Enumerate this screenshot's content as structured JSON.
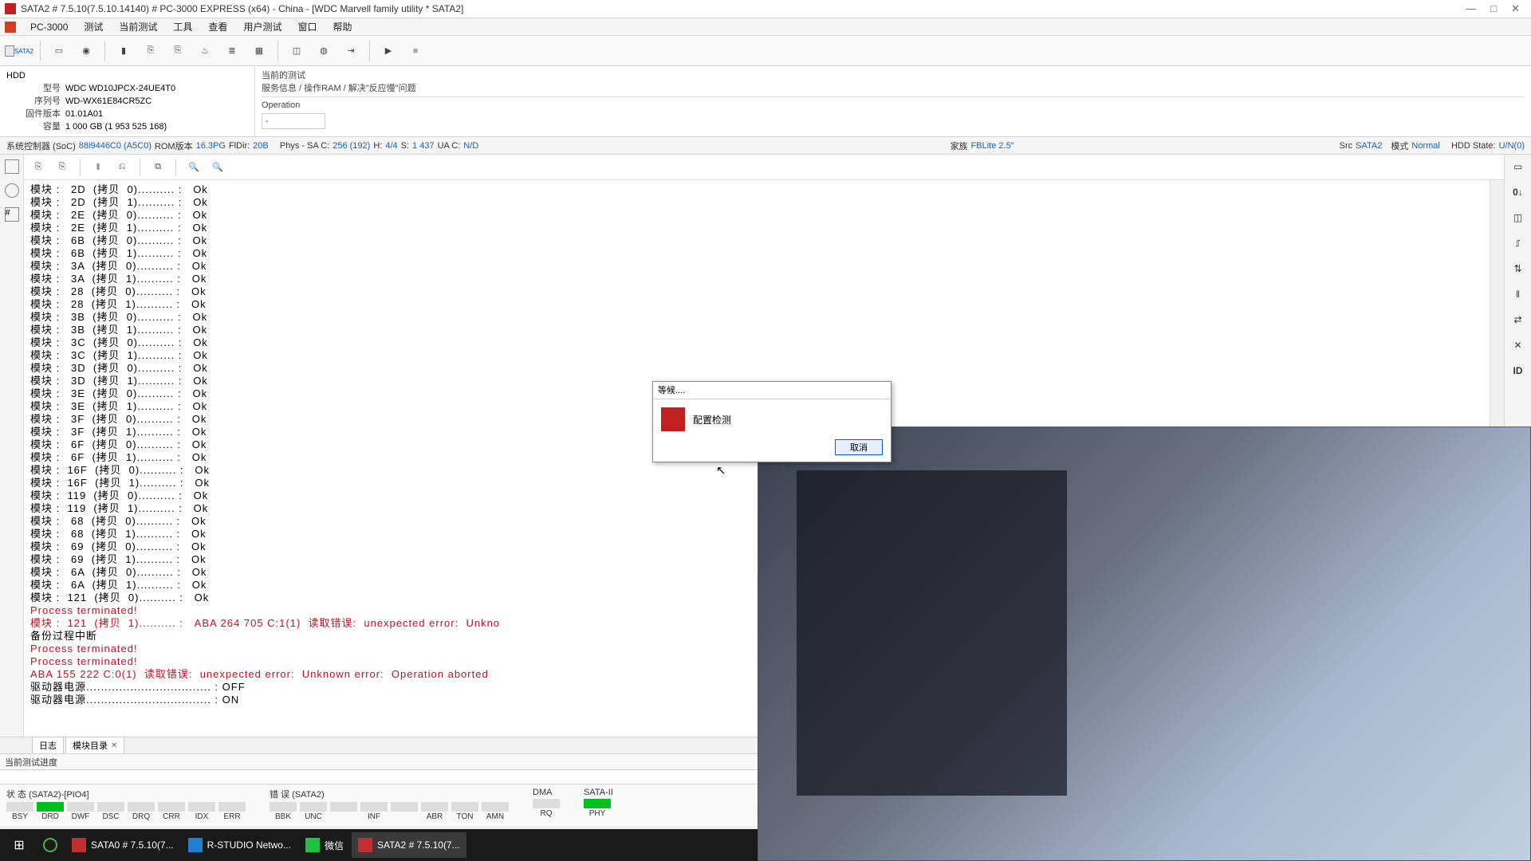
{
  "window": {
    "title": "SATA2 # 7.5.10(7.5.10.14140) # PC-3000 EXPRESS (x64) - China - [WDC Marvell family utility * SATA2]",
    "minimize": "—",
    "maximize": "□",
    "close": "✕"
  },
  "menubar": {
    "appname": "PC-3000",
    "items": [
      "测试",
      "当前测试",
      "工具",
      "查看",
      "用户测试",
      "窗口",
      "帮助"
    ]
  },
  "toolbar": {
    "sata_label": "SATA2",
    "play": "▶",
    "stop": "■"
  },
  "info": {
    "hdd_label": "HDD",
    "model_label": "型号",
    "model": "WDC WD10JPCX-24UE4T0",
    "serial_label": "序列号",
    "serial": "WD-WX61E84CR5ZC",
    "firmware_label": "固件版本",
    "firmware": "01.01A01",
    "capacity_label": "容量",
    "capacity": "1 000 GB (1 953 525 168)"
  },
  "test": {
    "current_label": "当前的测试",
    "current_value": "服务信息 / 操作RAM / 解决\"反应慢\"问题",
    "operation_label": "Operation",
    "dropdown": "-"
  },
  "statusline": {
    "soc_label": "系统控制器 (SoC)",
    "soc_value": "88i9446C0 (A5C0)",
    "rom_label": "ROM版本",
    "rom_value": "16.3PG",
    "fldir_label": "FlDir:",
    "fldir_value": "20B",
    "phys_label": "Phys - SA C:",
    "phys_value": "256 (192)",
    "h_label": "H:",
    "h_value": "4/4",
    "s_label": "S:",
    "s_value": "1 437",
    "uac_label": "UA C:",
    "uac_value": "N/D",
    "family_label": "家族",
    "family_value": "FBLite 2.5\"",
    "src_label": "Src",
    "src_value": "SATA2",
    "mode_label": "模式",
    "mode_value": "Normal",
    "hddstate_label": "HDD State:",
    "hddstate_value": "U/N(0)"
  },
  "log_lines": [
    {
      "text": "模块 :   2D  (拷贝  0).......... :   Ok",
      "cls": ""
    },
    {
      "text": "模块 :   2D  (拷贝  1).......... :   Ok",
      "cls": ""
    },
    {
      "text": "模块 :   2E  (拷贝  0).......... :   Ok",
      "cls": ""
    },
    {
      "text": "模块 :   2E  (拷贝  1).......... :   Ok",
      "cls": ""
    },
    {
      "text": "模块 :   6B  (拷贝  0).......... :   Ok",
      "cls": ""
    },
    {
      "text": "模块 :   6B  (拷贝  1).......... :   Ok",
      "cls": ""
    },
    {
      "text": "模块 :   3A  (拷贝  0).......... :   Ok",
      "cls": ""
    },
    {
      "text": "模块 :   3A  (拷贝  1).......... :   Ok",
      "cls": ""
    },
    {
      "text": "模块 :   28  (拷贝  0).......... :   Ok",
      "cls": ""
    },
    {
      "text": "模块 :   28  (拷贝  1).......... :   Ok",
      "cls": ""
    },
    {
      "text": "模块 :   3B  (拷贝  0).......... :   Ok",
      "cls": ""
    },
    {
      "text": "模块 :   3B  (拷贝  1).......... :   Ok",
      "cls": ""
    },
    {
      "text": "模块 :   3C  (拷贝  0).......... :   Ok",
      "cls": ""
    },
    {
      "text": "模块 :   3C  (拷贝  1).......... :   Ok",
      "cls": ""
    },
    {
      "text": "模块 :   3D  (拷贝  0).......... :   Ok",
      "cls": ""
    },
    {
      "text": "模块 :   3D  (拷贝  1).......... :   Ok",
      "cls": ""
    },
    {
      "text": "模块 :   3E  (拷贝  0).......... :   Ok",
      "cls": ""
    },
    {
      "text": "模块 :   3E  (拷贝  1).......... :   Ok",
      "cls": ""
    },
    {
      "text": "模块 :   3F  (拷贝  0).......... :   Ok",
      "cls": ""
    },
    {
      "text": "模块 :   3F  (拷贝  1).......... :   Ok",
      "cls": ""
    },
    {
      "text": "模块 :   6F  (拷贝  0).......... :   Ok",
      "cls": ""
    },
    {
      "text": "模块 :   6F  (拷贝  1).......... :   Ok",
      "cls": ""
    },
    {
      "text": "模块 :  16F  (拷贝  0).......... :   Ok",
      "cls": ""
    },
    {
      "text": "模块 :  16F  (拷贝  1).......... :   Ok",
      "cls": ""
    },
    {
      "text": "模块 :  119  (拷贝  0).......... :   Ok",
      "cls": ""
    },
    {
      "text": "模块 :  119  (拷贝  1).......... :   Ok",
      "cls": ""
    },
    {
      "text": "模块 :   68  (拷贝  0).......... :   Ok",
      "cls": ""
    },
    {
      "text": "模块 :   68  (拷贝  1).......... :   Ok",
      "cls": ""
    },
    {
      "text": "模块 :   69  (拷贝  0).......... :   Ok",
      "cls": ""
    },
    {
      "text": "模块 :   69  (拷贝  1).......... :   Ok",
      "cls": ""
    },
    {
      "text": "模块 :   6A  (拷贝  0).......... :   Ok",
      "cls": ""
    },
    {
      "text": "模块 :   6A  (拷贝  1).......... :   Ok",
      "cls": ""
    },
    {
      "text": "模块 :  121  (拷贝  0).......... :   Ok",
      "cls": ""
    },
    {
      "text": "Process terminated!",
      "cls": "red"
    },
    {
      "text": "模块 :  121  (拷贝  1).......... :   ABA 264 705 C:1(1)  读取错误:  unexpected error:  Unkno",
      "cls": "red"
    },
    {
      "text": "备份过程中断",
      "cls": ""
    },
    {
      "text": "",
      "cls": ""
    },
    {
      "text": "Process terminated!",
      "cls": "red"
    },
    {
      "text": "Process terminated!",
      "cls": "red"
    },
    {
      "text": "ABA 155 222 C:0(1)  读取错误:  unexpected error:  Unknown error:  Operation aborted",
      "cls": "red"
    },
    {
      "text": "驱动器电源.................................. : OFF",
      "cls": ""
    },
    {
      "text": "驱动器电源.................................. : ON",
      "cls": ""
    }
  ],
  "tabs": {
    "log": "日志",
    "modules": "模块目录"
  },
  "progress_label": "当前测试进度",
  "panels": {
    "status": {
      "title": "状 态 (SATA2)-[PIO4]",
      "chips": [
        "BSY",
        "DRD",
        "DWF",
        "DSC",
        "DRQ",
        "CRR",
        "IDX",
        "ERR"
      ],
      "green": [
        1
      ]
    },
    "errors": {
      "title": "错 误 (SATA2)",
      "chips": [
        "BBK",
        "UNC",
        "",
        "INF",
        "",
        "ABR",
        "TON",
        "AMN"
      ],
      "green": []
    },
    "dma": {
      "title": "DMA",
      "chips": [
        "RQ"
      ],
      "green": []
    },
    "sataii": {
      "title": "SATA-II",
      "chips": [
        "PHY"
      ],
      "green": [
        0
      ]
    }
  },
  "dialog": {
    "title": "等候....",
    "text": "配置检测",
    "button": "取消"
  },
  "taskbar": {
    "items": [
      {
        "label": "SATA0 # 7.5.10(7...",
        "icon": "#c03030"
      },
      {
        "label": "R-STUDIO Netwo...",
        "icon": "#2080d0"
      },
      {
        "label": "微信",
        "icon": "#20c040"
      },
      {
        "label": "SATA2 # 7.5.10(7...",
        "icon": "#c03030",
        "active": true
      }
    ]
  }
}
